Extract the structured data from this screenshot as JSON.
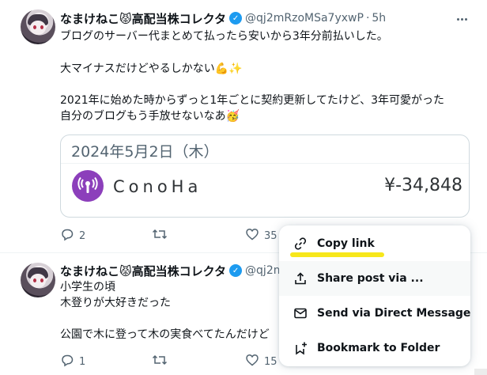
{
  "post1": {
    "author_name": "なまけねこ😾高配当株コレクタ",
    "handle": "@qj2mRzoMSa7yxwP",
    "time": "5h",
    "lines": [
      "ブログのサーバー代まとめて払ったら安いから3年分前払いした。",
      "大マイナスだけどやるしかない💪✨",
      "2021年に始めた時からずっと1年ごとに契約更新してたけど、3年可愛がった",
      "自分のブログもう手放せないなあ🥳"
    ],
    "card": {
      "date": "2024年5月2日（木）",
      "brand": "ConoHa",
      "amount": "¥-34,848"
    },
    "stats": {
      "replies": "2",
      "likes": "35"
    }
  },
  "post2": {
    "author_name": "なまけねこ😾高配当株コレクタ",
    "handle": "@qj2m",
    "lines": [
      "小学生の頃",
      "木登りが大好きだった",
      "公園で木に登って木の実食べてたんだけど"
    ],
    "stats": {
      "replies": "1",
      "likes": "15"
    }
  },
  "menu": {
    "items": [
      {
        "label": "Copy link",
        "icon": "link-icon"
      },
      {
        "label": "Share post via ...",
        "icon": "share-icon"
      },
      {
        "label": "Send via Direct Message",
        "icon": "envelope-icon"
      },
      {
        "label": "Bookmark to Folder",
        "icon": "bookmark-plus-icon"
      }
    ]
  },
  "colors": {
    "accent": "#1d9bf0",
    "secondary_text": "#536471",
    "brand_purple": "#8c3fbb",
    "highlight": "#f7e71b"
  }
}
